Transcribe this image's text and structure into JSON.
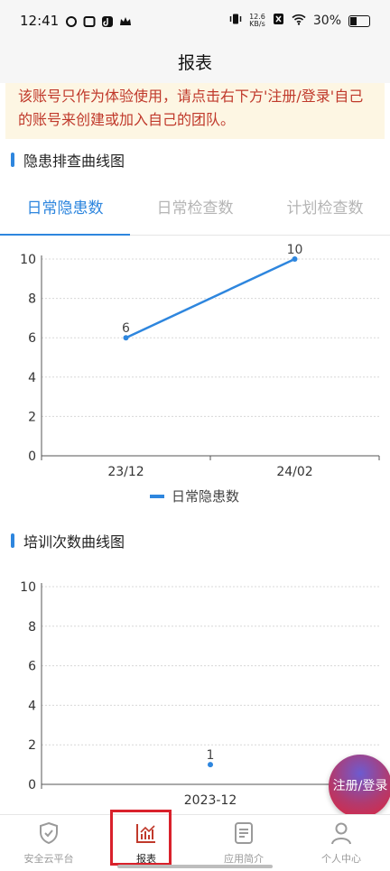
{
  "status_bar": {
    "time": "12:41",
    "net_speed_value": "12.6",
    "net_speed_unit": "KB/s",
    "battery": "30%"
  },
  "header": {
    "title": "报表"
  },
  "notice": {
    "text": "该账号只作为体验使用，请点击右下方'注册/登录'自己的账号来创建或加入自己的团队。"
  },
  "section1": {
    "title": "隐患排查曲线图"
  },
  "tabs": [
    {
      "label": "日常隐患数"
    },
    {
      "label": "日常检查数"
    },
    {
      "label": "计划检查数"
    }
  ],
  "section2": {
    "title": "培训次数曲线图"
  },
  "chart_data": [
    {
      "type": "line",
      "x": [
        "23/12",
        "24/02"
      ],
      "series": [
        {
          "name": "日常隐患数",
          "values": [
            6,
            10
          ]
        }
      ],
      "data_labels": [
        "6",
        "10"
      ],
      "ylim": [
        0,
        10
      ],
      "yticks": [
        0,
        2,
        4,
        6,
        8,
        10
      ],
      "grid": true,
      "legend": "bottom-center",
      "color": "#2e86de"
    },
    {
      "type": "line",
      "x": [
        "2023-12"
      ],
      "series": [
        {
          "values": [
            1
          ]
        }
      ],
      "data_labels": [
        "1"
      ],
      "ylim": [
        0,
        10
      ],
      "yticks": [
        0,
        2,
        4,
        6,
        8,
        10
      ],
      "grid": true,
      "color": "#2e86de"
    }
  ],
  "fab": {
    "label": "注册/登录"
  },
  "bottom_nav": [
    {
      "label": "安全云平台",
      "icon": "shield-check-icon"
    },
    {
      "label": "报表",
      "icon": "chart-icon"
    },
    {
      "label": "应用简介",
      "icon": "document-icon"
    },
    {
      "label": "个人中心",
      "icon": "user-icon"
    }
  ]
}
